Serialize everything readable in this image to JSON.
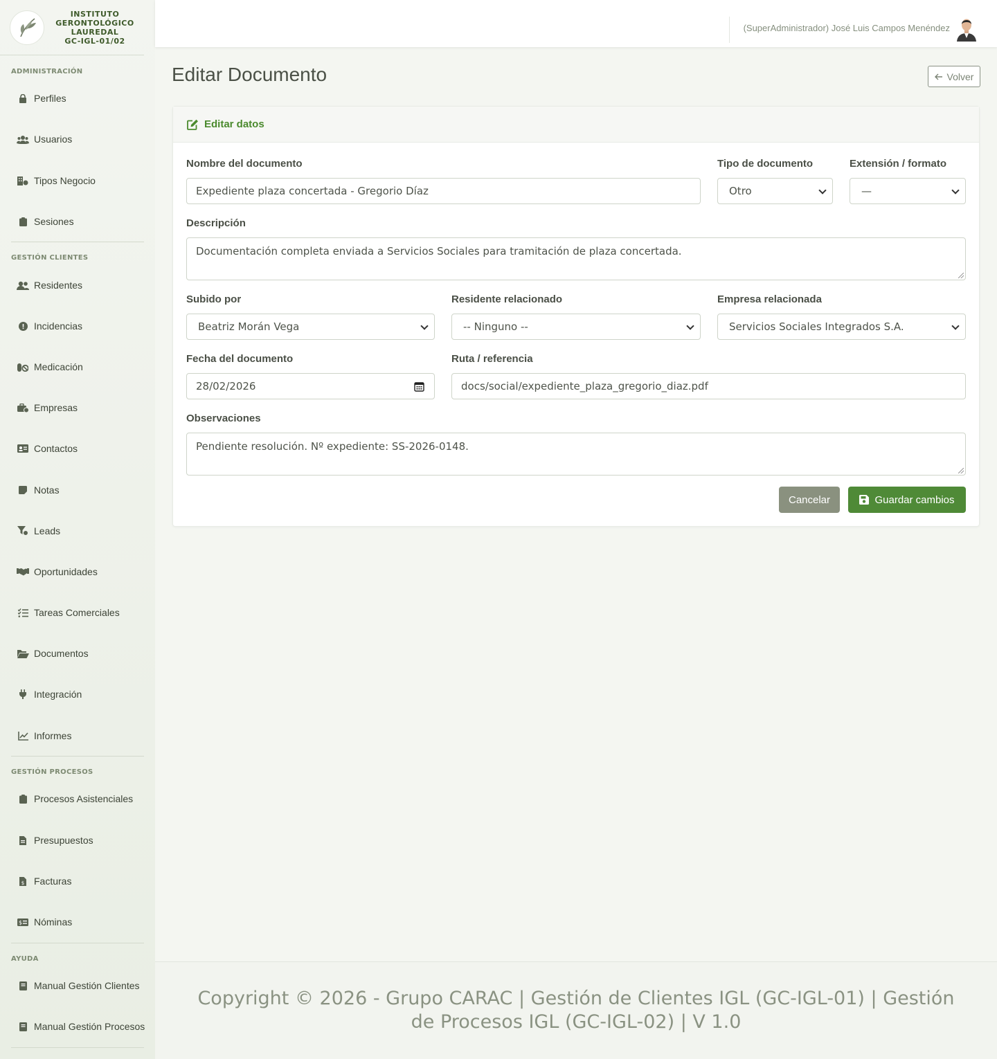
{
  "brand": {
    "line1": "INSTITUTO",
    "line2": "GERONTOLÓGICO",
    "line3": "LAUREDAL",
    "line4": "GC-IGL-01/02"
  },
  "sidebar": {
    "sections": [
      {
        "title": "Administración"
      },
      {
        "title": "Gestión Clientes"
      },
      {
        "title": "Gestión Procesos"
      },
      {
        "title": "Ayuda"
      }
    ],
    "items": [
      {
        "label": "Perfiles",
        "icon": "lock-icon"
      },
      {
        "label": "Usuarios",
        "icon": "users-icon"
      },
      {
        "label": "Tipos Negocio",
        "icon": "building-icon"
      },
      {
        "label": "Sesiones",
        "icon": "clipboard-icon"
      },
      {
        "label": "Residentes",
        "icon": "user-group-icon"
      },
      {
        "label": "Incidencias",
        "icon": "alert-circle-icon"
      },
      {
        "label": "Medicación",
        "icon": "pills-icon"
      },
      {
        "label": "Empresas",
        "icon": "briefcase-icon"
      },
      {
        "label": "Contactos",
        "icon": "id-card-icon"
      },
      {
        "label": "Notas",
        "icon": "sticky-note-icon"
      },
      {
        "label": "Leads",
        "icon": "funnel-icon"
      },
      {
        "label": "Oportunidades",
        "icon": "handshake-icon"
      },
      {
        "label": "Tareas Comerciales",
        "icon": "tasks-icon"
      },
      {
        "label": "Documentos",
        "icon": "folder-open-icon"
      },
      {
        "label": "Integración",
        "icon": "plug-icon"
      },
      {
        "label": "Informes",
        "icon": "line-chart-icon"
      },
      {
        "label": "Procesos Asistenciales",
        "icon": "clipboard-icon"
      },
      {
        "label": "Presupuestos",
        "icon": "file-icon"
      },
      {
        "label": "Facturas",
        "icon": "invoice-icon"
      },
      {
        "label": "Nóminas",
        "icon": "money-icon"
      },
      {
        "label": "Manual Gestión Clientes",
        "icon": "book-icon"
      },
      {
        "label": "Manual Gestión Procesos",
        "icon": "book-icon"
      }
    ]
  },
  "topbar": {
    "user": "(SuperAdministrador) José Luis Campos Menéndez"
  },
  "page": {
    "title": "Editar Documento",
    "back_label": "Volver"
  },
  "form": {
    "header": "Editar datos",
    "nombre_label": "Nombre del documento",
    "nombre_value": "Expediente plaza concertada - Gregorio Díaz",
    "tipo_label": "Tipo de documento",
    "tipo_value": "Otro",
    "ext_label": "Extensión / formato",
    "ext_value": "—",
    "descripcion_label": "Descripción",
    "descripcion_value": "Documentación completa enviada a Servicios Sociales para tramitación de plaza concertada.",
    "subido_label": "Subido por",
    "subido_value": "Beatriz Morán Vega",
    "residente_label": "Residente relacionado",
    "residente_value": "-- Ninguno --",
    "empresa_label": "Empresa relacionada",
    "empresa_value": "Servicios Sociales Integrados S.A.",
    "fecha_label": "Fecha del documento",
    "fecha_value": "28/02/2026",
    "ruta_label": "Ruta / referencia",
    "ruta_value": "docs/social/expediente_plaza_gregorio_diaz.pdf",
    "observaciones_label": "Observaciones",
    "observaciones_value": "Pendiente resolución. Nº expediente: SS-2026-0148.",
    "cancel_label": "Cancelar",
    "save_label": "Guardar cambios"
  },
  "footer": {
    "text": "Copyright © 2026 - Grupo CARAC | Gestión de Clientes IGL (GC-IGL-01) | Gestión de Procesos IGL (GC-IGL-02) | V 1.0"
  },
  "colors": {
    "accent": "#4b8a2e",
    "save_button": "#4f8a37",
    "cancel_button": "#8a917f"
  }
}
